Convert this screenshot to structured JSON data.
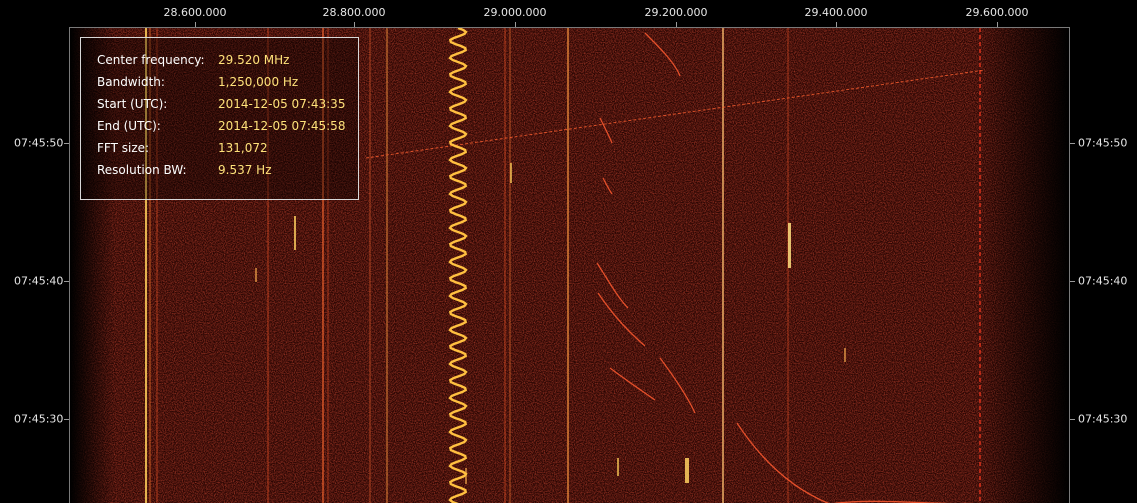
{
  "frequency_axis": {
    "ticks": [
      "28.600.000",
      "28.800.000",
      "29.000.000",
      "29.200.000",
      "29.400.000",
      "29.600.000"
    ]
  },
  "time_axis": {
    "ticks": [
      "07:45:50",
      "07:45:40",
      "07:45:30"
    ]
  },
  "info": {
    "rows": [
      {
        "label": "Center frequency:",
        "value": "29.520 MHz"
      },
      {
        "label": "Bandwidth:",
        "value": "1,250,000 Hz"
      },
      {
        "label": "Start (UTC):",
        "value": "2014-12-05 07:43:35"
      },
      {
        "label": "End (UTC):",
        "value": "2014-12-05 07:45:58"
      },
      {
        "label": "FFT size:",
        "value": "131,072"
      },
      {
        "label": "Resolution BW:",
        "value": "9.537 Hz"
      }
    ]
  },
  "colors": {
    "background": "#000000",
    "waterfall_base": "#2a0603",
    "signal": "#ff5a28",
    "signal_hot": "#ffd060",
    "info_value": "#ffe27a"
  }
}
